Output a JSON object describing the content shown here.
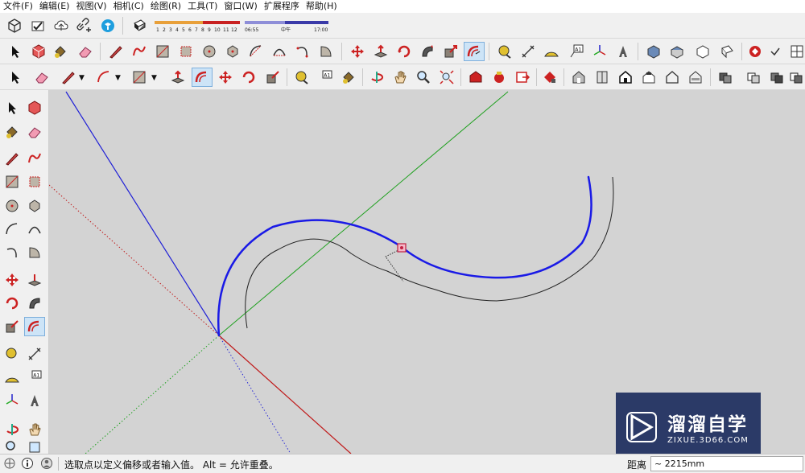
{
  "menu": [
    "文件(F)",
    "编辑(E)",
    "视图(V)",
    "相机(C)",
    "绘图(R)",
    "工具(T)",
    "窗口(W)",
    "扩展程序",
    "帮助(H)"
  ],
  "shadow": {
    "month_ticks": [
      "1",
      "2",
      "3",
      "4",
      "5",
      "6",
      "7",
      "8",
      "9",
      "10",
      "11",
      "12"
    ],
    "time_start": "06:55",
    "time_mid": "中午",
    "time_end": "17:00"
  },
  "status": {
    "message": "选取点以定义偏移或者输入值。 Alt = 允许重叠。",
    "measure_label": "距离",
    "measure_value": "~ 2215mm"
  },
  "watermark": {
    "brand": "溜溜自学",
    "url": "ZIXUE.3D66.COM"
  },
  "colors": {
    "viewport_bg": "#d3d3d3",
    "axis_blue": "#1f1fd6",
    "axis_green": "#1fa01f",
    "axis_red": "#c01a1a",
    "selected_curve": "#1a1ae6",
    "offset_curve": "#222222",
    "active_tool_bg": "#cde4f7"
  },
  "active_tool": "offset-tool"
}
